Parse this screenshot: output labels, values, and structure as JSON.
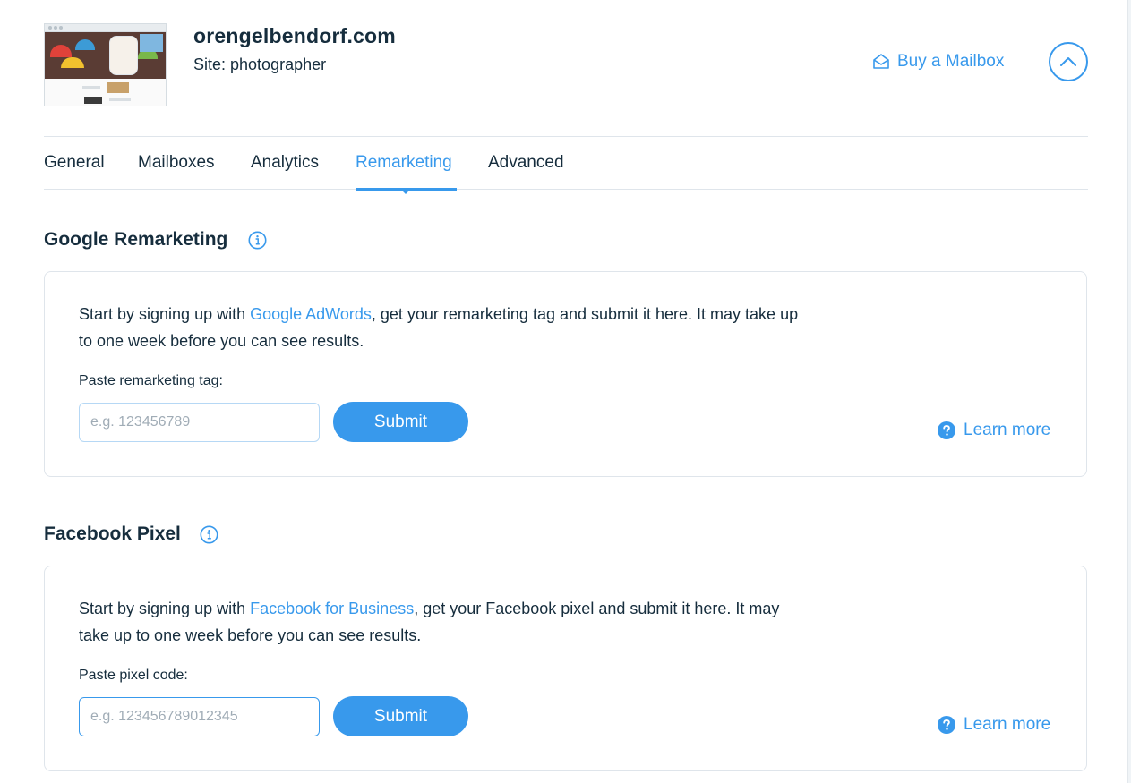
{
  "site": {
    "domain": "orengelbendorf.com",
    "type_label": "Site: photographer"
  },
  "header": {
    "buy_mailbox_label": "Buy a Mailbox",
    "buy_mailbox_icon": "envelope-open-icon",
    "collapse_icon": "chevron-up-icon"
  },
  "tabs": [
    {
      "label": "General",
      "active": false
    },
    {
      "label": "Mailboxes",
      "active": false
    },
    {
      "label": "Analytics",
      "active": false
    },
    {
      "label": "Remarketing",
      "active": true
    },
    {
      "label": "Advanced",
      "active": false
    }
  ],
  "google": {
    "title": "Google Remarketing",
    "desc_before": "Start by signing up with ",
    "desc_link": "Google AdWords",
    "desc_after": ", get your remarketing tag and submit it here. It may take up to one week before you can see results.",
    "field_label": "Paste remarketing tag:",
    "placeholder": "e.g. 123456789",
    "value": "",
    "submit_label": "Submit",
    "learn_more_label": "Learn more"
  },
  "facebook": {
    "title": "Facebook Pixel",
    "desc_before": "Start by signing up with ",
    "desc_link": "Facebook for Business",
    "desc_after": ", get your Facebook pixel and submit it here. It may take up to one week before you can see results.",
    "field_label": "Paste pixel code:",
    "placeholder": "e.g. 123456789012345",
    "value": "",
    "submit_label": "Submit",
    "learn_more_label": "Learn more"
  },
  "colors": {
    "accent": "#3899ec",
    "text": "#162d3d",
    "border": "#dfe5eb"
  }
}
